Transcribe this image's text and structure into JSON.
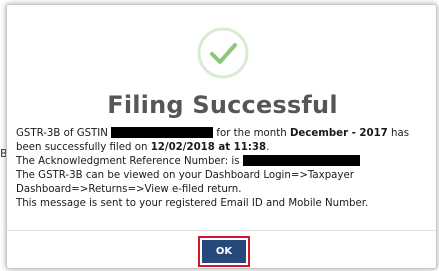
{
  "dialog": {
    "title": "Filing Successful",
    "status_icon": "check-circle-icon",
    "colors": {
      "check": "#8cc57e",
      "check_ring": "#d9ebd3",
      "title": "#565656",
      "ok_button": "#27497a",
      "focus_ring": "#d0172b"
    },
    "message": {
      "line1_prefix": "GSTR-3B of GSTIN",
      "line1_middle": "for the month",
      "month": "December - 2017",
      "line1_suffix": "has",
      "line2_prefix": "been successfully filed on",
      "filed_on": "12/02/2018 at 11:38",
      "line2_suffix": ".",
      "ack_label": "The Acknowledgment Reference Number: is",
      "dashboard_line1": "The GSTR-3B can be viewed on your Dashboard Login=>Taxpayer",
      "dashboard_line2": "Dashboard=>Returns=>View e-filed return.",
      "email_note": "This message is sent to your registered Email ID and Mobile Number."
    },
    "ok_label": "OK"
  },
  "background": {
    "glyph": "B"
  }
}
